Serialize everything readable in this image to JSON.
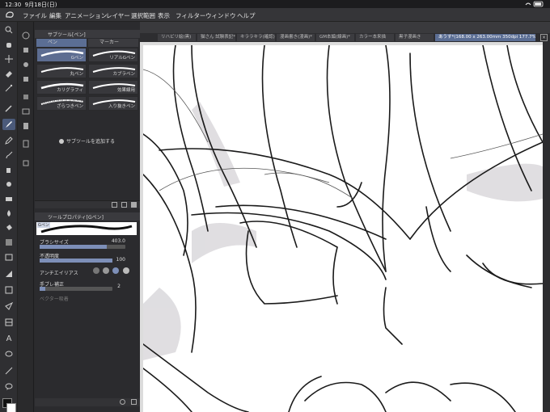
{
  "status": {
    "time": "12:30",
    "date": "9月18日(日)",
    "battery": "●"
  },
  "menu": {
    "items": [
      {
        "label": "ファイル",
        "name": "menu-file"
      },
      {
        "label": "編集",
        "name": "menu-edit"
      },
      {
        "label": "アニメーション",
        "name": "menu-animation"
      },
      {
        "label": "レイヤー",
        "name": "menu-layer"
      },
      {
        "label": "選択範囲",
        "name": "menu-selection"
      },
      {
        "label": "表示",
        "name": "menu-view"
      },
      {
        "label": "フィルター",
        "name": "menu-filter"
      },
      {
        "label": "ウィンドウ",
        "name": "menu-window"
      },
      {
        "label": "ヘルプ",
        "name": "menu-help"
      }
    ]
  },
  "subtool": {
    "header": "サブツール[ペン]",
    "tabs": [
      "ペン",
      "マーカー"
    ],
    "brushes": [
      "Gペン",
      "リアルGペン",
      "丸ペン",
      "カブラペン",
      "カリグラフィ",
      "効果線用",
      "ざらつきペン",
      "入り抜きペン"
    ],
    "add": "サブツールを追加する"
  },
  "toolprop": {
    "header": "ツールプロパティ[Gペン]",
    "preview_label": "Gペン",
    "brush_size_label": "ブラシサイズ",
    "brush_size_value": "403.0",
    "opacity_label": "不透明度",
    "opacity_value": "100",
    "antialias_label": "アンチエイリアス",
    "stabilize_label": "手ブレ補正",
    "stabilize_value": "2",
    "vector_label": "ベクター吸着"
  },
  "doc": {
    "tabs": [
      "リハビリ絵(黒)",
      "猫さん 試験表記*",
      "キララキラ(確認)",
      "漫画書き(漫画)*",
      "GM本編(線画)*",
      "カラー本来描",
      "黒子漫画き",
      "あうす*(168.00 x 263.00mm 350dpi 177.7%)"
    ]
  }
}
